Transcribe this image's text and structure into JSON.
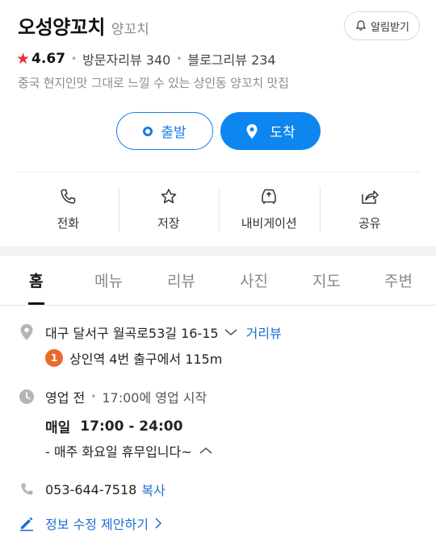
{
  "header": {
    "store_name": "오성양꼬치",
    "category": "양꼬치",
    "alarm_label": "알림받기"
  },
  "summary": {
    "rating": "4.67",
    "visitor_reviews": "방문자리뷰 340",
    "blog_reviews": "블로그리뷰 234",
    "description": "중국 현지인맛 그대로 느낄 수 있는 상인동 양꼬치 맛집"
  },
  "route": {
    "start_label": "출발",
    "end_label": "도착"
  },
  "actions": [
    {
      "label": "전화",
      "icon": "phone-icon"
    },
    {
      "label": "저장",
      "icon": "star-outline-icon"
    },
    {
      "label": "내비게이션",
      "icon": "navigation-car-icon"
    },
    {
      "label": "공유",
      "icon": "share-icon"
    }
  ],
  "tabs": [
    {
      "label": "홈",
      "active": true
    },
    {
      "label": "메뉴"
    },
    {
      "label": "리뷰"
    },
    {
      "label": "사진"
    },
    {
      "label": "지도"
    },
    {
      "label": "주변"
    }
  ],
  "info": {
    "address": "대구 달서구 월곡로53길 16-15",
    "street_view_label": "거리뷰",
    "station_number": "1",
    "station_text": "상인역 4번 출구에서 115m",
    "status": "영업 전",
    "status_detail": "17:00에 영업 시작",
    "hours_day": "매일",
    "hours_time": "17:00 - 24:00",
    "holiday": "- 매주 화요일 휴무입니다~",
    "phone": "053-644-7518",
    "copy_label": "복사",
    "suggest_edit": "정보 수정 제안하기"
  },
  "colors": {
    "accent_blue": "#0e86f0",
    "link_blue": "#1b6fd1",
    "star_red": "#e8302f",
    "badge_orange": "#ea6a2d"
  }
}
